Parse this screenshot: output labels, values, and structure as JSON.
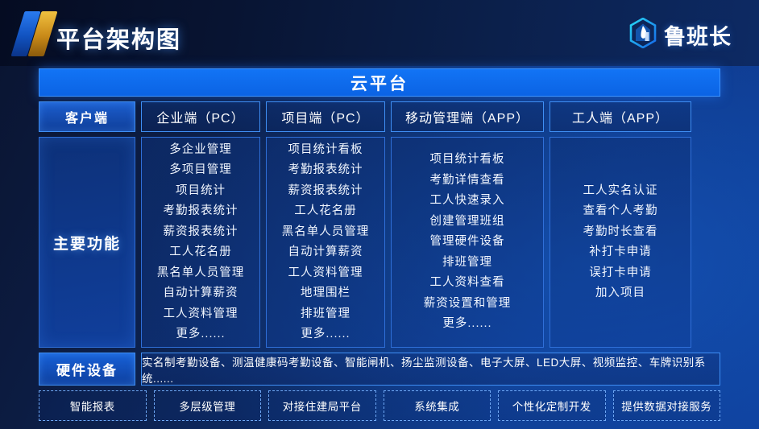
{
  "header": {
    "title": "平台架构图",
    "brand_name": "鲁班长",
    "logo_icon": "hexagon-building-logo-icon",
    "accent_blue": "#1d6ff0",
    "accent_gold": "#d79a1c"
  },
  "cloud_bar": {
    "label": "云平台"
  },
  "tabs": [
    {
      "label": "客户端",
      "primary": true
    },
    {
      "label": "企业端（PC）",
      "primary": false
    },
    {
      "label": "项目端（PC）",
      "primary": false
    },
    {
      "label": "移动管理端（APP）",
      "primary": false
    },
    {
      "label": "工人端（APP）",
      "primary": false
    }
  ],
  "main": {
    "label": "主要功能",
    "columns": [
      {
        "name": "enterprise-pc",
        "items": [
          "多企业管理",
          "多项目管理",
          "项目统计",
          "考勤报表统计",
          "薪资报表统计",
          "工人花名册",
          "黑名单人员管理",
          "自动计算薪资",
          "工人资料管理",
          "更多......"
        ]
      },
      {
        "name": "project-pc",
        "items": [
          "项目统计看板",
          "考勤报表统计",
          "薪资报表统计",
          "工人花名册",
          "黑名单人员管理",
          "自动计算薪资",
          "工人资料管理",
          "地理围栏",
          "排班管理",
          "更多......"
        ]
      },
      {
        "name": "mobile-admin-app",
        "items": [
          "项目统计看板",
          "考勤详情查看",
          "工人快速录入",
          "创建管理班组",
          "管理硬件设备",
          "排班管理",
          "工人资料查看",
          "薪资设置和管理",
          "更多......"
        ]
      },
      {
        "name": "worker-app",
        "items": [
          "工人实名认证",
          "查看个人考勤",
          "考勤时长查看",
          "补打卡申请",
          "误打卡申请",
          "加入项目"
        ]
      }
    ]
  },
  "hardware": {
    "label": "硬件设备",
    "list": "实名制考勤设备、测温健康码考勤设备、智能闸机、扬尘监测设备、电子大屏、LED大屏、视频监控、车牌识别系统......"
  },
  "bottom_chips": [
    "智能报表",
    "多层级管理",
    "对接住建局平台",
    "系统集成",
    "个性化定制开发",
    "提供数据对接服务"
  ]
}
